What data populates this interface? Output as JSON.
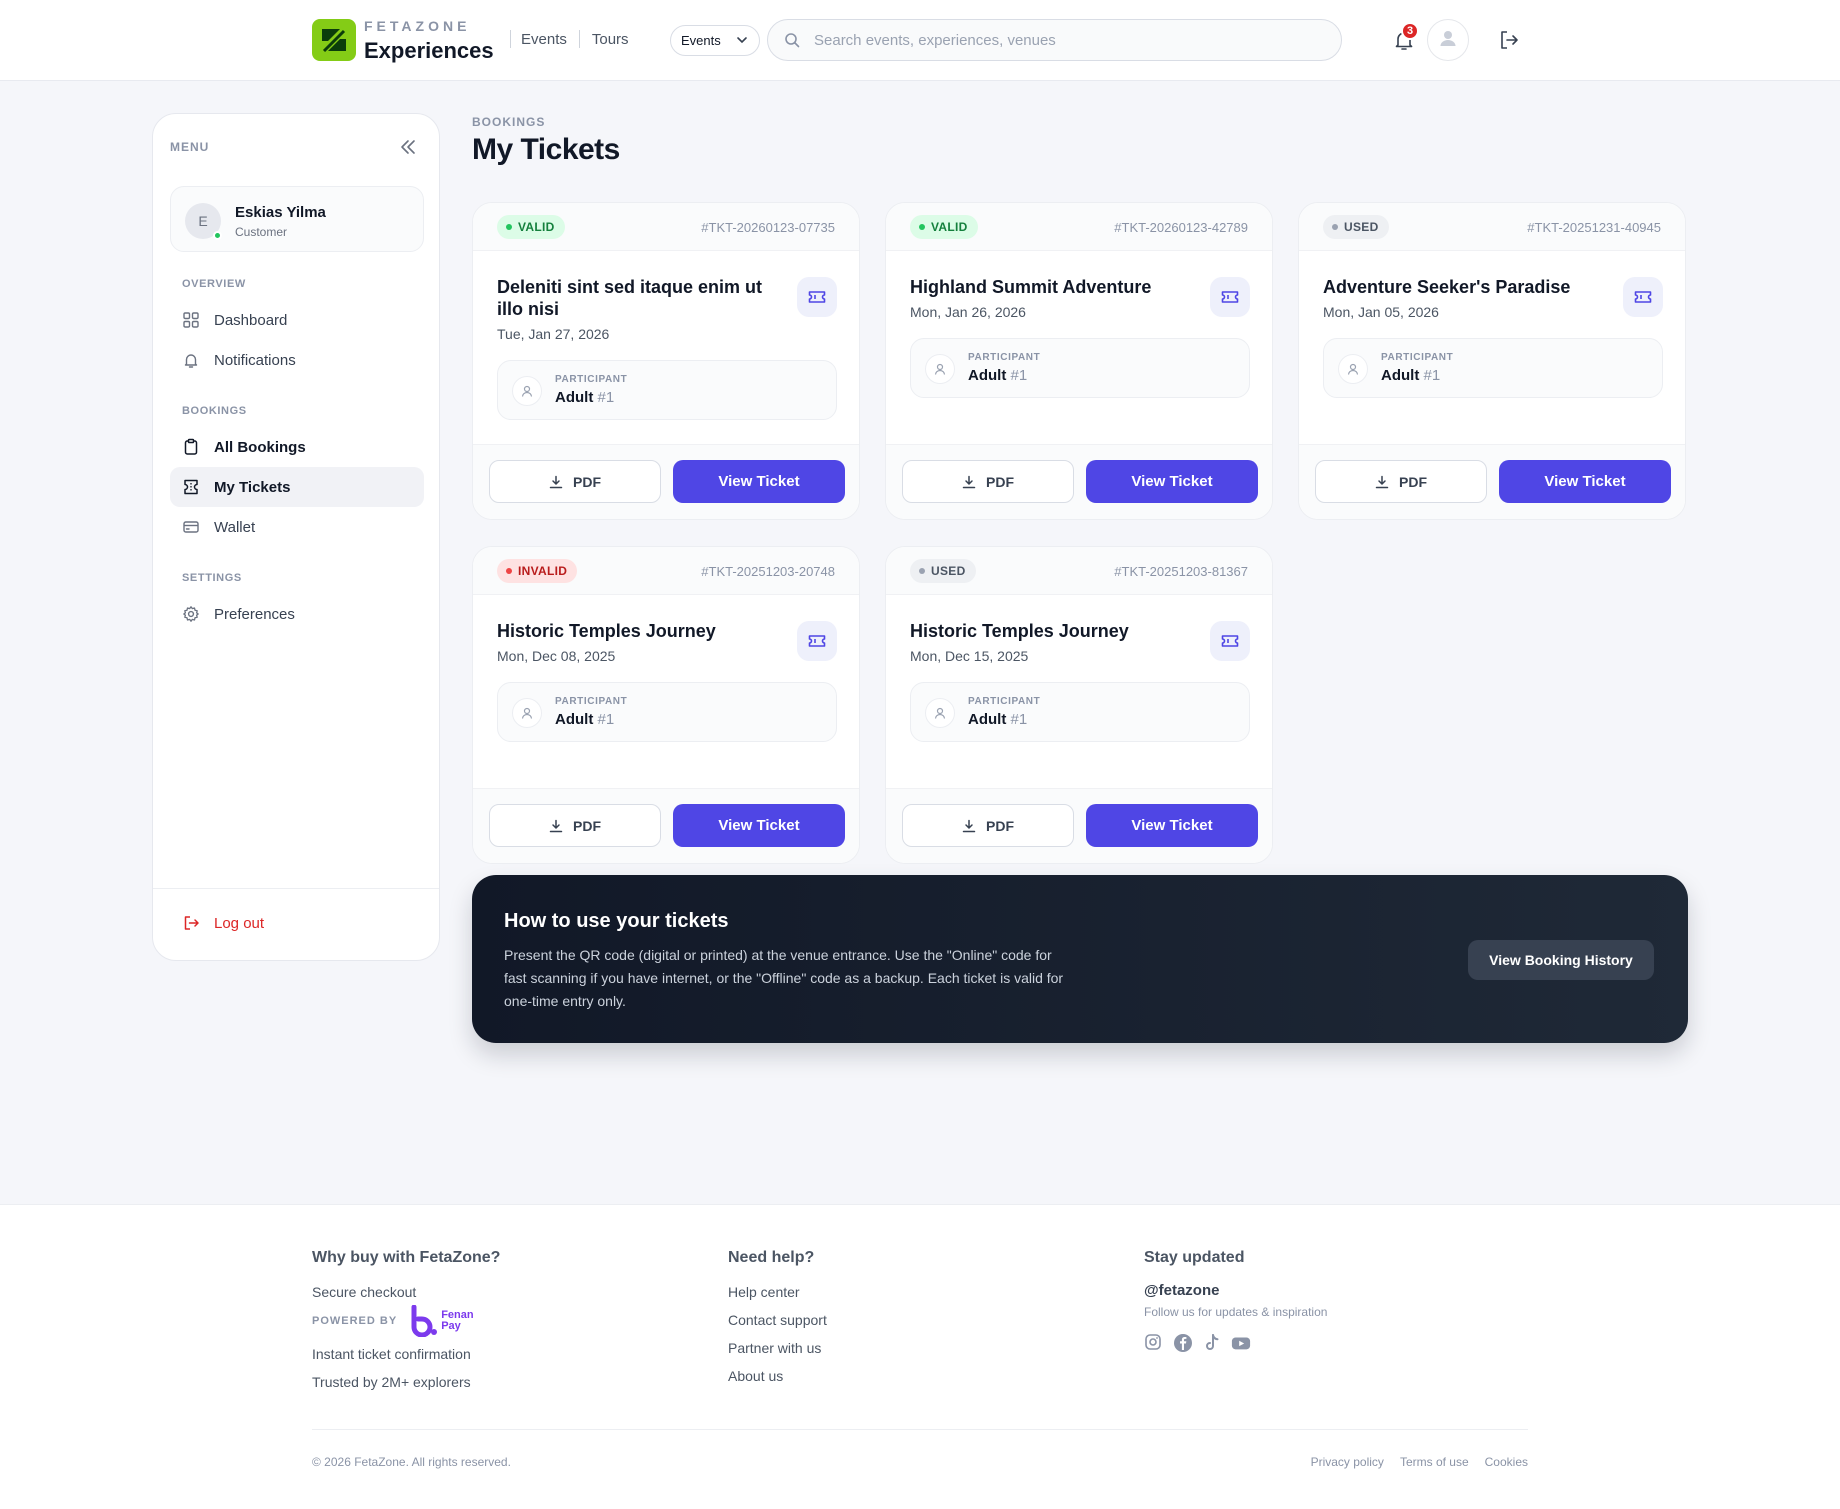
{
  "header": {
    "brand_top": "FETAZONE",
    "brand_main": "Experiences",
    "nav": [
      "Events",
      "Tours"
    ],
    "type_select": "Events",
    "search_placeholder": "Search events, experiences, venues",
    "notifications_count": "3"
  },
  "sidebar": {
    "menu_label": "MENU",
    "user": {
      "initial": "E",
      "name": "Eskias Yilma",
      "role": "Customer"
    },
    "sections": {
      "overview": "OVERVIEW",
      "bookings": "BOOKINGS",
      "settings": "SETTINGS"
    },
    "items": {
      "dashboard": "Dashboard",
      "notifications": "Notifications",
      "all_bookings": "All Bookings",
      "my_tickets": "My Tickets",
      "wallet": "Wallet",
      "preferences": "Preferences"
    },
    "logout": "Log out"
  },
  "main": {
    "crumb": "BOOKINGS",
    "title": "My Tickets",
    "participant_label": "PARTICIPANT",
    "pdf_label": "PDF",
    "view_label": "View Ticket",
    "tickets": [
      {
        "status": "VALID",
        "code": "#TKT-20260123-07735",
        "title": "Deleniti sint sed itaque enim ut illo nisi",
        "date": "Tue, Jan 27, 2026",
        "participant": "Adult",
        "participant_num": "#1"
      },
      {
        "status": "VALID",
        "code": "#TKT-20260123-42789",
        "title": "Highland Summit Adventure",
        "date": "Mon, Jan 26, 2026",
        "participant": "Adult",
        "participant_num": "#1"
      },
      {
        "status": "USED",
        "code": "#TKT-20251231-40945",
        "title": "Adventure Seeker's Paradise",
        "date": "Mon, Jan 05, 2026",
        "participant": "Adult",
        "participant_num": "#1"
      },
      {
        "status": "INVALID",
        "code": "#TKT-20251203-20748",
        "title": "Historic Temples Journey",
        "date": "Mon, Dec 08, 2025",
        "participant": "Adult",
        "participant_num": "#1"
      },
      {
        "status": "USED",
        "code": "#TKT-20251203-81367",
        "title": "Historic Temples Journey",
        "date": "Mon, Dec 15, 2025",
        "participant": "Adult",
        "participant_num": "#1"
      }
    ]
  },
  "help": {
    "title": "How to use your tickets",
    "text": "Present the QR code (digital or printed) at the venue entrance. Use the \"Online\" code for fast scanning if you have internet, or the \"Offline\" code as a backup. Each ticket is valid for one-time entry only.",
    "button": "View Booking History"
  },
  "footer": {
    "col1": {
      "title": "Why buy with FetaZone?",
      "secure": "Secure checkout",
      "powered_by": "POWERED BY",
      "fenan": "Fenan",
      "pay": "Pay",
      "instant": "Instant ticket confirmation",
      "trusted": "Trusted by 2M+ explorers"
    },
    "col2": {
      "title": "Need help?",
      "links": [
        "Help center",
        "Contact support",
        "Partner with us",
        "About us"
      ]
    },
    "col3": {
      "title": "Stay updated",
      "handle": "@fetazone",
      "follow": "Follow us for updates & inspiration"
    },
    "copyright": "© 2026 FetaZone. All rights reserved.",
    "legal": [
      "Privacy policy",
      "Terms of use",
      "Cookies"
    ]
  },
  "colors": {
    "accent": "#4f46e5",
    "brand": "#84cc16",
    "valid": "#22c55e",
    "invalid": "#dc2626",
    "dark_banner": "#111827"
  },
  "icons": [
    "logo-icon",
    "chevron-down-icon",
    "search-icon",
    "bell-icon",
    "user-icon",
    "logout-icon",
    "collapse-icon",
    "grid-icon",
    "clipboard-icon",
    "ticket-icon",
    "wallet-icon",
    "gear-icon",
    "download-icon",
    "instagram-icon",
    "facebook-icon",
    "tiktok-icon",
    "youtube-icon"
  ]
}
